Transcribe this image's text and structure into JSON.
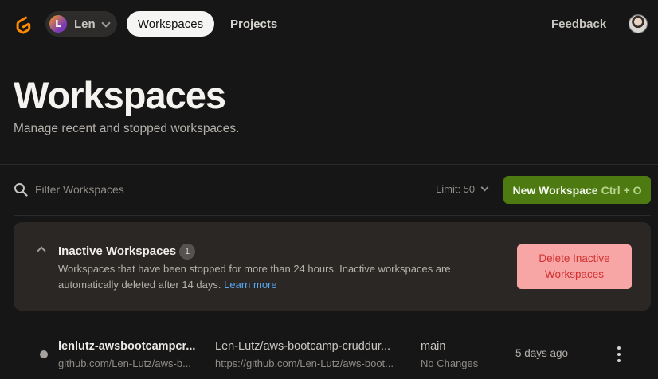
{
  "header": {
    "org_initial": "L",
    "org_name": "Len",
    "nav_active": "Workspaces",
    "nav_projects": "Projects",
    "feedback": "Feedback",
    "logo_icon": "gitpod-logo-icon",
    "logo_color": "#FF8A00"
  },
  "page": {
    "title": "Workspaces",
    "subtitle": "Manage recent and stopped workspaces."
  },
  "toolbar": {
    "search_placeholder": "Filter Workspaces",
    "limit_label": "Limit: 50",
    "new_workspace_label": "New Workspace",
    "new_workspace_shortcut": "Ctrl + O",
    "new_workspace_color": "#4E7A12"
  },
  "inactive": {
    "title": "Inactive Workspaces",
    "count": "1",
    "description": "Workspaces that have been stopped for more than 24 hours. Inactive workspaces are automatically deleted after 14 days.",
    "learn_more": "Learn more",
    "delete_label": "Delete Inactive Workspaces",
    "delete_bg": "#F8A5A5",
    "delete_text_color": "#D0312F"
  },
  "workspaces": [
    {
      "name": "lenlutz-awsbootcampcr...",
      "context": "github.com/Len-Lutz/aws-b...",
      "repo": "Len-Lutz/aws-bootcamp-cruddur...",
      "repo_url": "https://github.com/Len-Lutz/aws-boot...",
      "branch": "main",
      "changes": "No Changes",
      "last_active": "5 days ago"
    }
  ]
}
